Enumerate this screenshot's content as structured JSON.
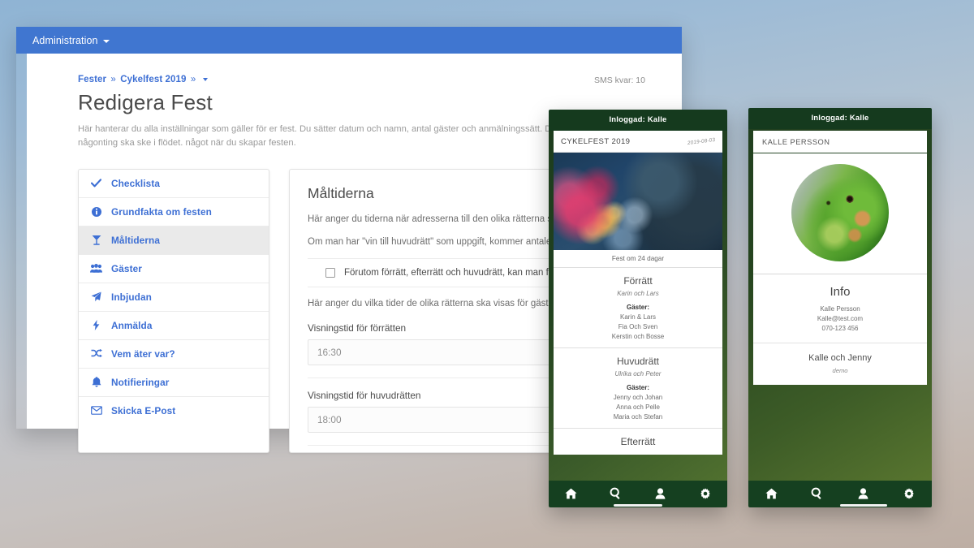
{
  "admin": {
    "navbar": {
      "brand": "Administration",
      "caret_icon": "caret-down-icon"
    },
    "breadcrumb": {
      "root": "Fester",
      "sep": "»",
      "current": "Cykelfest 2019",
      "sep2": "»",
      "caret_icon": "caret-down-icon"
    },
    "sms_counter": "SMS kvar: 10",
    "page_title": "Redigera Fest",
    "page_description": "Här hanterar du alla inställningar som gäller för er fest. Du sätter datum och namn, antal gäster och anmälningssätt. Dessutom sätter du när någonting ska ske i flödet. något när du skapar festen.",
    "menu": [
      {
        "label": "Checklista",
        "icon": "check-icon",
        "active": false
      },
      {
        "label": "Grundfakta om festen",
        "icon": "info-circle-icon",
        "active": false
      },
      {
        "label": "Måltiderna",
        "icon": "cocktail-glass-icon",
        "active": true
      },
      {
        "label": "Gäster",
        "icon": "users-icon",
        "active": false
      },
      {
        "label": "Inbjudan",
        "icon": "paper-plane-icon",
        "active": false
      },
      {
        "label": "Anmälda",
        "icon": "bolt-icon",
        "active": false
      },
      {
        "label": "Vem äter var?",
        "icon": "shuffle-icon",
        "active": false
      },
      {
        "label": "Notifieringar",
        "icon": "bell-icon",
        "active": false
      },
      {
        "label": "Skicka E-Post",
        "icon": "envelope-icon",
        "active": false
      }
    ],
    "panel": {
      "heading": "Måltiderna",
      "para1": "Här anger du tiderna när adresserna till den olika rätterna skall visas.",
      "para2": "Om man har \"vin till huvudrätt\" som uppgift, kommer antalet par per måltid att bli annorlunda.",
      "checkbox": {
        "label": "Förutom förrätt, efterrätt och huvudrätt, kan man få \"vin till huvudrätten\" som uppgift",
        "checked": false
      },
      "para3": "Här anger du vilka tider de olika rätterna ska visas för gästerna. De meddelanden som kommer skickas vid samma tidpunkter.",
      "fields": [
        {
          "label": "Visningstid för förrätten",
          "value": "16:30"
        },
        {
          "label": "Visningstid för huvudrätten",
          "value": "18:00"
        }
      ]
    }
  },
  "phone1": {
    "status": "Inloggad: Kalle",
    "fest_title": "CYKELFEST 2019",
    "fest_date": "2019-08-03",
    "countdown": "Fest om 24 dagar",
    "meals": [
      {
        "name": "Förrätt",
        "hosts": "Karin och Lars",
        "guests_label": "Gäster:",
        "guests": [
          "Karin & Lars",
          "Fia Och Sven",
          "Kerstin och Bosse"
        ]
      },
      {
        "name": "Huvudrätt",
        "hosts": "Ulrika och Peter",
        "guests_label": "Gäster:",
        "guests": [
          "Jenny och Johan",
          "Anna och Pelle",
          "Maria och Stefan"
        ]
      },
      {
        "name": "Efterrätt",
        "hosts": "",
        "guests_label": "",
        "guests": []
      }
    ],
    "nav": [
      {
        "icon": "home-icon",
        "active": false
      },
      {
        "icon": "search-icon",
        "active": true
      },
      {
        "icon": "person-icon",
        "active": false
      },
      {
        "icon": "gear-icon",
        "active": false
      }
    ]
  },
  "phone2": {
    "status": "Inloggad: Kalle",
    "header": "KALLE PERSSON",
    "avatar": "iguana-avatar",
    "info_heading": "Info",
    "info_lines": [
      "Kalle Persson",
      "Kalle@test.com",
      "070-123 456"
    ],
    "couple_name": "Kalle och Jenny",
    "couple_sub": "demo",
    "nav": [
      {
        "icon": "home-icon",
        "active": false
      },
      {
        "icon": "search-icon",
        "active": false
      },
      {
        "icon": "person-icon",
        "active": true
      },
      {
        "icon": "gear-icon",
        "active": false
      }
    ]
  },
  "colors": {
    "brand_blue": "#4076d0",
    "link_blue": "#3d6fd4",
    "phone_green_dark": "#153a1e",
    "phone_nav_green": "#154020"
  }
}
